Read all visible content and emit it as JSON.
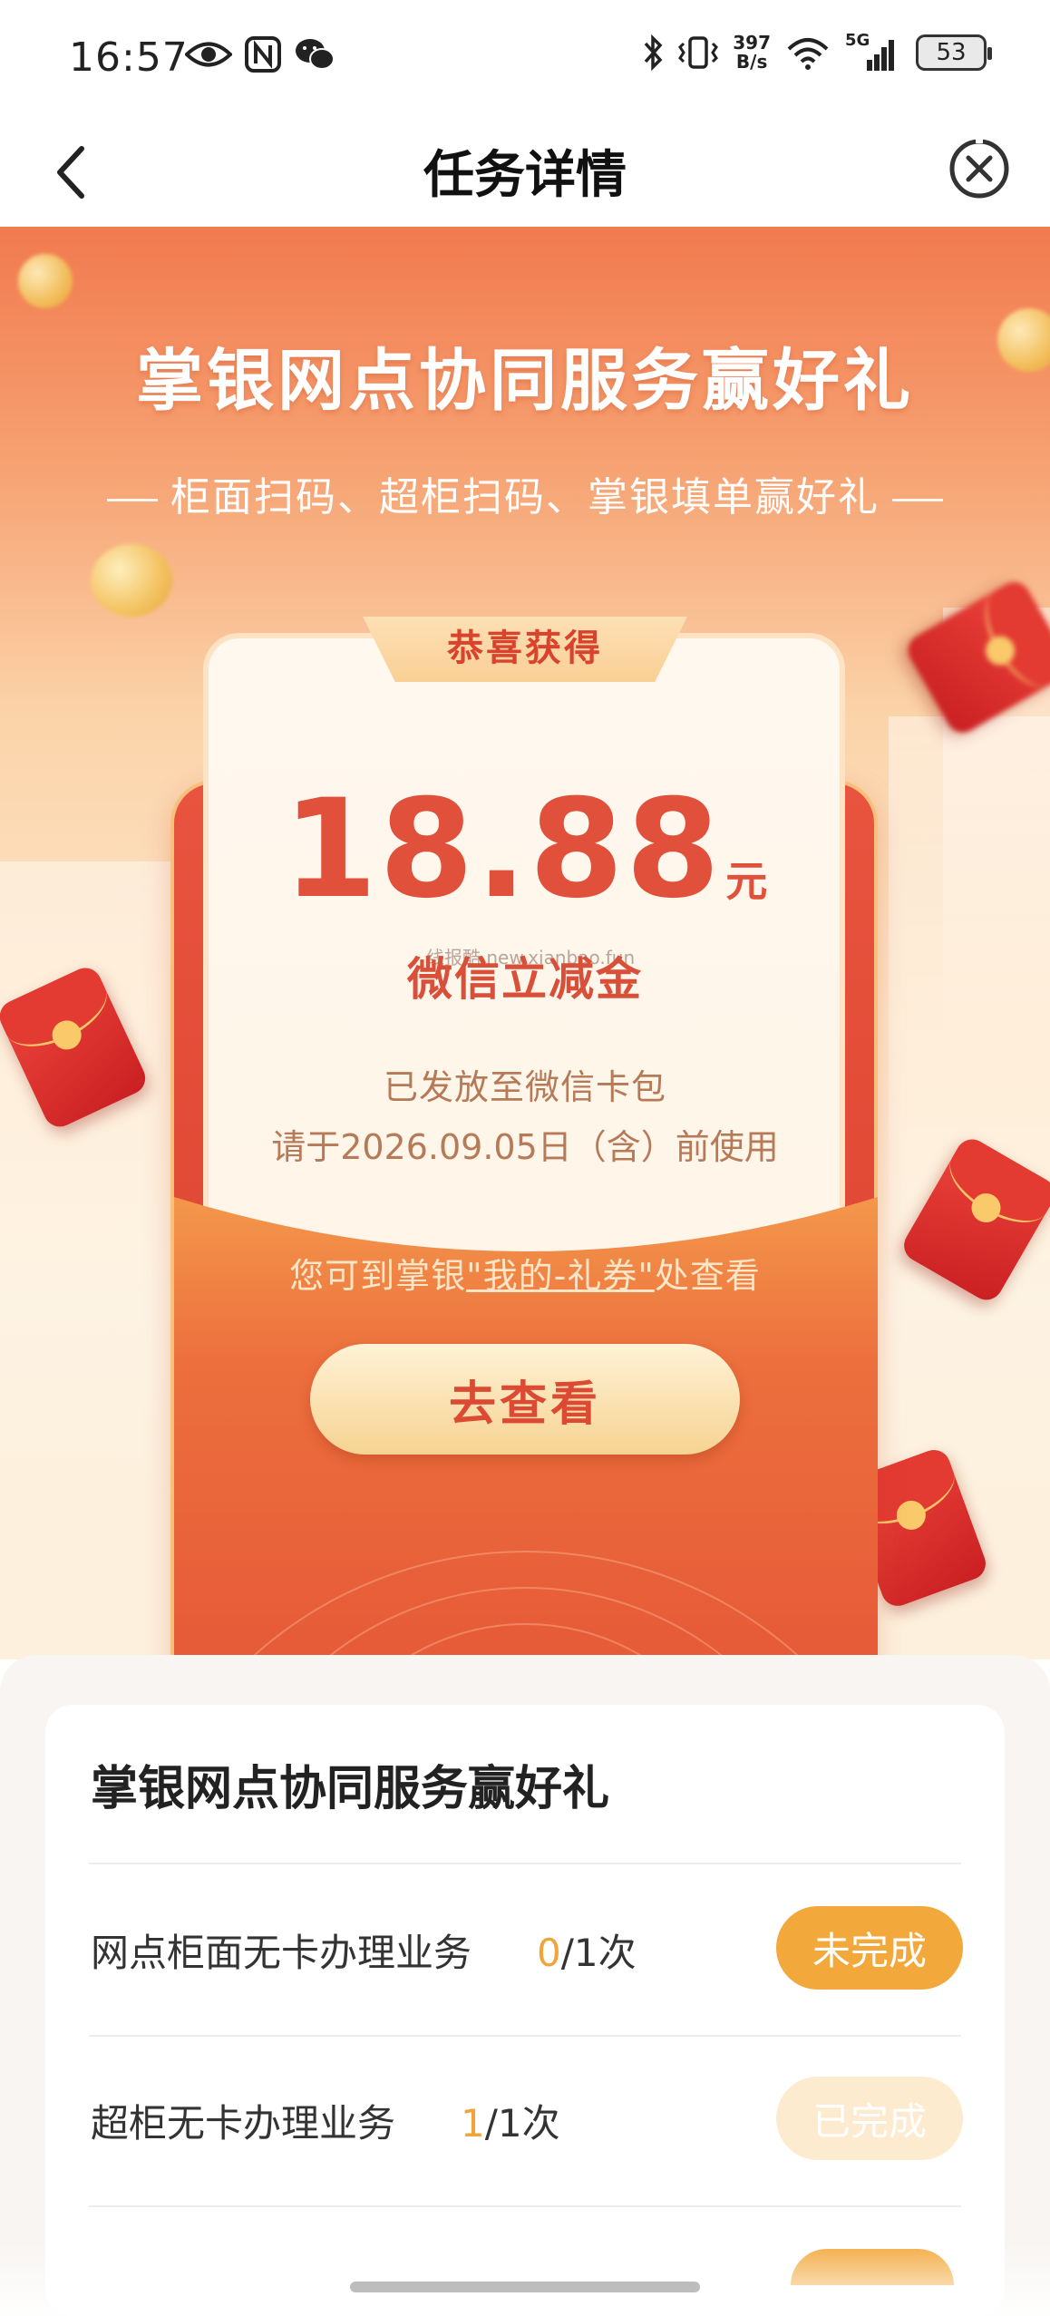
{
  "status_bar": {
    "time": "16:57",
    "net_speed_value": "397",
    "net_speed_unit": "B/s",
    "network_type": "5G",
    "battery": "53",
    "left_icons": [
      "eye-icon",
      "nfc-icon",
      "wechat-icon"
    ],
    "right_icons": [
      "bluetooth-icon",
      "vibrate-icon",
      "wifi-icon",
      "signal-icon",
      "battery-icon"
    ]
  },
  "nav": {
    "title": "任务详情",
    "back_icon": "chevron-left-icon",
    "close_icon": "close-circle-icon"
  },
  "hero": {
    "title": "掌银网点协同服务赢好礼",
    "subtitle": "柜面扫码、超柜扫码、掌银填单赢好礼"
  },
  "reward_card": {
    "ribbon": "恭喜获得",
    "amount": "18.88",
    "unit": "元",
    "amount_label": "微信立减金",
    "watermark": "线报酷 new.xianbao.fun",
    "sent_text": "已发放至微信卡包",
    "deadline_text": "请于2026.09.05日（含）前使用",
    "hint_prefix": "您可到掌银",
    "hint_link": "\"我的-礼券\"",
    "hint_suffix": "处查看",
    "go_button": "去查看"
  },
  "tasks": {
    "title": "掌银网点协同服务赢好礼",
    "items": [
      {
        "label": "网点柜面无卡办理业务",
        "done_count": "0",
        "total": "/1次",
        "status": "未完成"
      },
      {
        "label": "超柜无卡办理业务",
        "done_count": "1",
        "total": "/1次",
        "status": "已完成"
      }
    ]
  },
  "colors": {
    "accent_orange": "#f3a83c",
    "brand_red": "#e0503a",
    "done_light": "#fdebcf"
  }
}
